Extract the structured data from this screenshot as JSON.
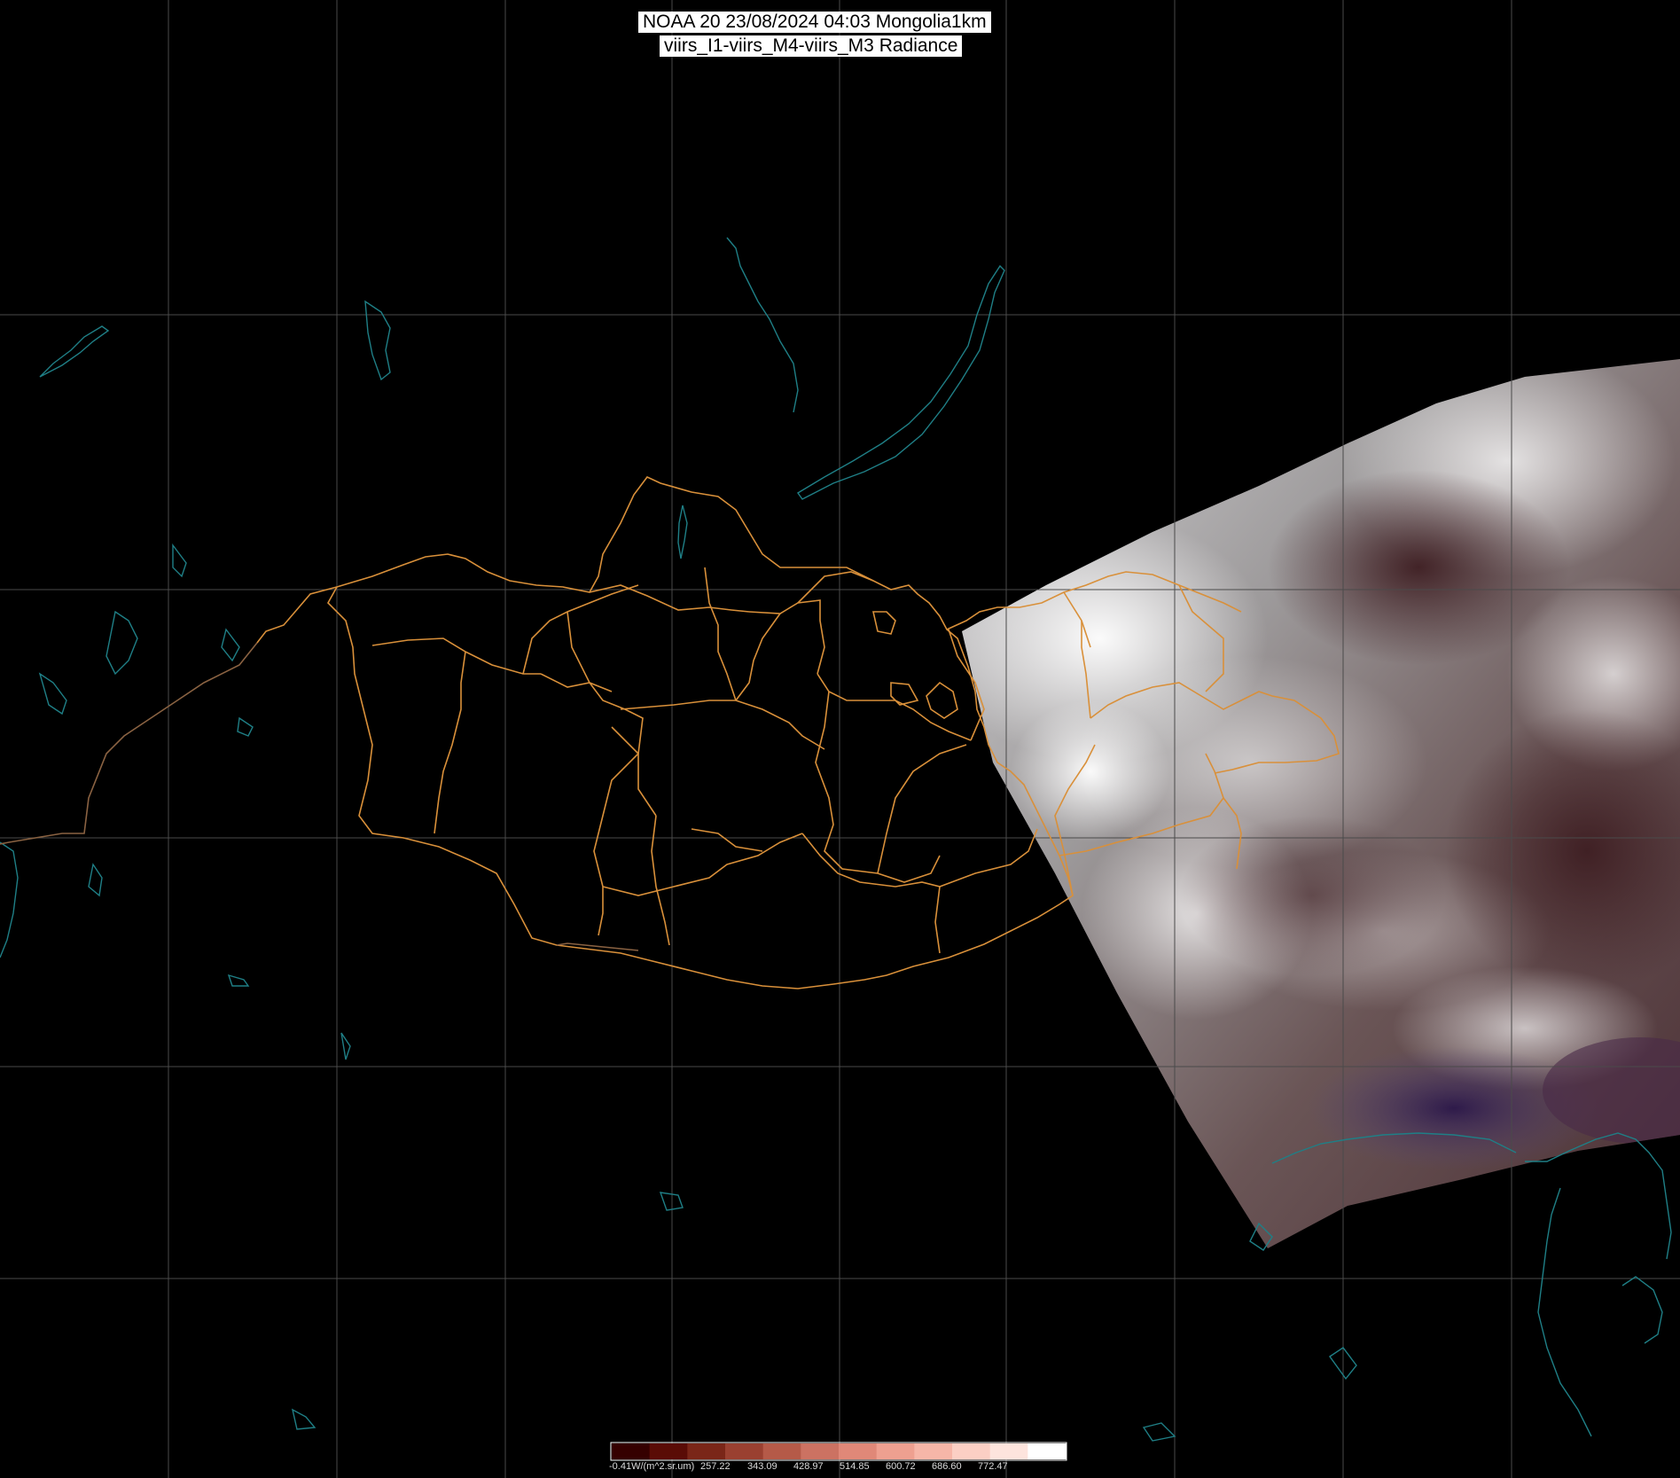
{
  "title": {
    "line1": "NOAA 20 23/08/2024 04:03 Mongolia1km",
    "line2": "viirs_I1-viirs_M4-viirs_M3 Radiance"
  },
  "colors": {
    "background": "#000000",
    "graticule": "#4a4a4a",
    "border": "#d9903a",
    "coast": "#1f7f86"
  },
  "legend": {
    "labels": [
      "-0.41W/(m^2.sr.um)",
      "257.22",
      "343.09",
      "428.97",
      "514.85",
      "600.72",
      "686.60",
      "772.47"
    ],
    "swatches": [
      "#350000",
      "#5a0c06",
      "#7a2618",
      "#9a4030",
      "#b55a48",
      "#cc7262",
      "#e08878",
      "#eea090",
      "#f6b6a8",
      "#fbcfc4",
      "#fde4dd",
      "#ffffff"
    ]
  }
}
